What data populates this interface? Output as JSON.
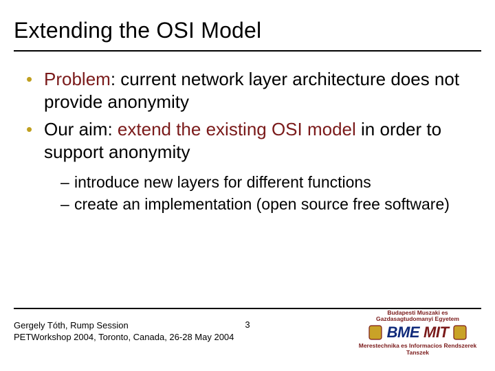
{
  "title": "Extending the OSI Model",
  "bullets": [
    {
      "lead": "Problem",
      "lead_colon": ": ",
      "tail": "current network layer architecture does not provide anonymity"
    },
    {
      "pre": "Our aim: ",
      "highlight": "extend the existing OSI model",
      "post": " in order to support anonymity"
    }
  ],
  "sub_bullets": [
    "introduce new layers for different functions",
    "create an implementation (open source free software)"
  ],
  "footer": {
    "line1": "Gergely Tóth, Rump Session",
    "line2": "PETWorkshop 2004, Toronto, Canada, 26-28 May 2004"
  },
  "page_number": "3",
  "logo": {
    "toptext_line1": "Budapesti Muszaki es",
    "toptext_line2": "Gazdasagtudomanyi Egyetem",
    "bme": "BME",
    "mit": "MIT",
    "bottomtext": "Merestechnika es Informacios Rendszerek Tanszek"
  }
}
